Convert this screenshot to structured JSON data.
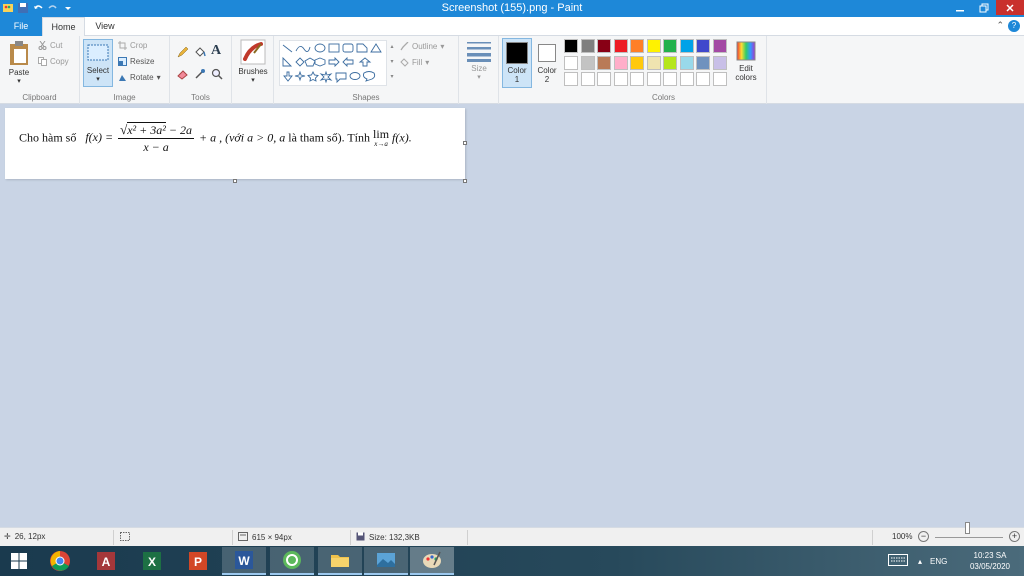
{
  "window": {
    "title": "Screenshot (155).png - Paint"
  },
  "tabs": {
    "file": "File",
    "home": "Home",
    "view": "View"
  },
  "clipboard": {
    "paste": "Paste",
    "cut": "Cut",
    "copy": "Copy",
    "label": "Clipboard"
  },
  "image": {
    "select": "Select",
    "crop": "Crop",
    "resize": "Resize",
    "rotate": "Rotate",
    "label": "Image"
  },
  "tools": {
    "label": "Tools",
    "text_tool": "A"
  },
  "brushes": {
    "label": "Brushes"
  },
  "shapes": {
    "outline": "Outline",
    "fill": "Fill",
    "label": "Shapes"
  },
  "size": {
    "label": "Size"
  },
  "color_selectors": {
    "color1": "Color",
    "color1_num": "1",
    "color2": "Color",
    "color2_num": "2",
    "color1_value": "#000000",
    "color2_value": "#ffffff"
  },
  "colors": {
    "label": "Colors",
    "edit": "Edit",
    "edit2": "colors",
    "palette_row1": [
      "#000000",
      "#7f7f7f",
      "#880015",
      "#ed1c24",
      "#ff7f27",
      "#fff200",
      "#22b14c",
      "#00a2e8",
      "#3f48cc",
      "#a349a4"
    ],
    "palette_row2": [
      "#ffffff",
      "#c3c3c3",
      "#b97a57",
      "#ffaec9",
      "#ffc90e",
      "#efe4b0",
      "#b5e61d",
      "#99d9ea",
      "#7092be",
      "#c8bfe7"
    ]
  },
  "canvas_content": {
    "cho_ham_so": "Cho hàm số",
    "fx": "f(x) =",
    "numerator_root": "x² + 3a²",
    "numerator_rest": " − 2a",
    "denominator": "x − a",
    "after_frac": "+ a , (với",
    "cond": "a > 0, a",
    "la_tham_so": "là tham số). Tính",
    "lim": "lim",
    "lim_sub": "x→a",
    "lim_fx": "f(x)."
  },
  "status": {
    "cursor": "26, 12px",
    "dimensions": "615 × 94px",
    "file_size": "Size: 132,3KB",
    "zoom": "100%"
  },
  "taskbar": {
    "lang": "ENG",
    "time": "10:23 SA",
    "date": "03/05/2020"
  }
}
